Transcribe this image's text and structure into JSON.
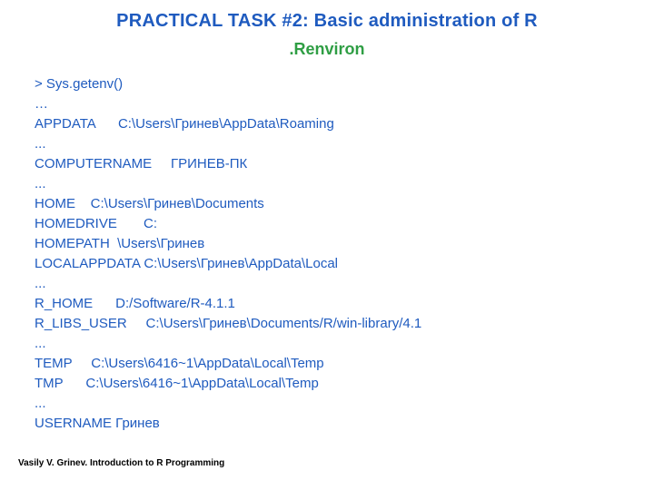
{
  "title": "PRACTICAL TASK #2: Basic administration of R",
  "subtitle": ".Renviron",
  "code_lines": [
    "> Sys.getenv()",
    "…",
    "APPDATA      C:\\Users\\Гринев\\AppData\\Roaming",
    "...",
    "COMPUTERNAME     ГРИНЕВ-ПК",
    "...",
    "HOME    C:\\Users\\Гринев\\Documents",
    "HOMEDRIVE       C:",
    "HOMEPATH  \\Users\\Гринев",
    "LOCALAPPDATA C:\\Users\\Гринев\\AppData\\Local",
    "...",
    "R_HOME      D:/Software/R-4.1.1",
    "R_LIBS_USER     C:\\Users\\Гринев\\Documents/R/win-library/4.1",
    "...",
    "TEMP     C:\\Users\\6416~1\\AppData\\Local\\Temp",
    "TMP      C:\\Users\\6416~1\\AppData\\Local\\Temp",
    "...",
    "USERNAME Гринев"
  ],
  "footer": "Vasily V. Grinev. Introduction to R Programming"
}
